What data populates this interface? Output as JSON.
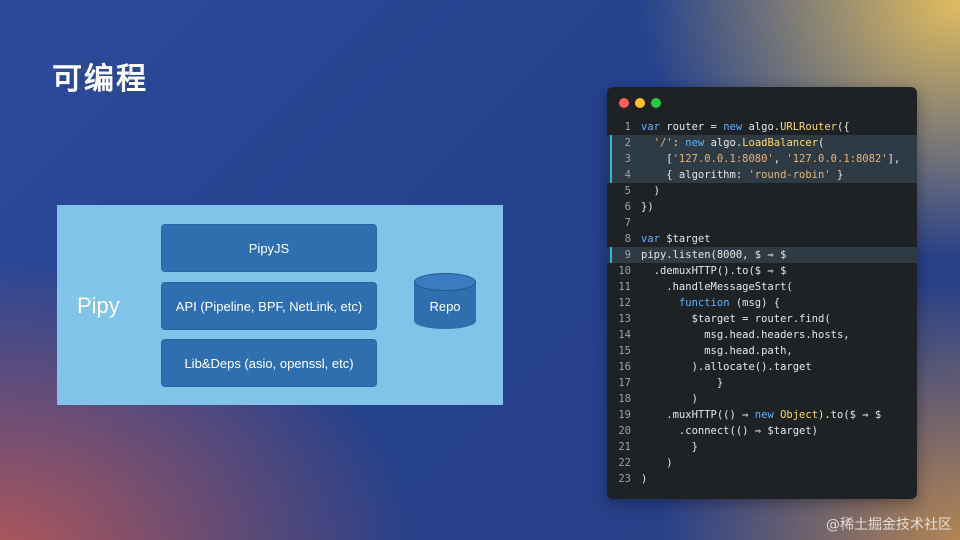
{
  "slide": {
    "title": "可编程",
    "watermark": "@稀土掘金技术社区"
  },
  "diagram": {
    "container_label": "Pipy",
    "layers": [
      "PipyJS",
      "API (Pipeline, BPF, NetLink, etc)",
      "Lib&Deps (asio, openssl, etc)"
    ],
    "repo_label": "Repo",
    "colors": {
      "panel": "#82c3ea",
      "box": "#2f6fb0"
    }
  },
  "code_window": {
    "traffic_lights": [
      "#ff5f56",
      "#ffbd2e",
      "#27c93f"
    ],
    "highlighted_lines": [
      2,
      3,
      4,
      9
    ],
    "lines": [
      "var router = new algo.URLRouter({",
      "  '/': new algo.LoadBalancer(",
      "    ['127.0.0.1:8080', '127.0.0.1:8082'],",
      "    { algorithm: 'round-robin' }",
      "  )",
      "})",
      "",
      "var $target",
      "pipy.listen(8000, $ ⇒ $",
      "  .demuxHTTP().to($ ⇒ $",
      "    .handleMessageStart(",
      "      function (msg) {",
      "        $target = router.find(",
      "          msg.head.headers.hosts,",
      "          msg.head.path,",
      "        ).allocate().target",
      "            }",
      "        )",
      "    .muxHTTP(() ⇒ new Object).to($ ⇒ $",
      "      .connect(() ⇒ $target)",
      "        }",
      "    )",
      ")"
    ]
  }
}
